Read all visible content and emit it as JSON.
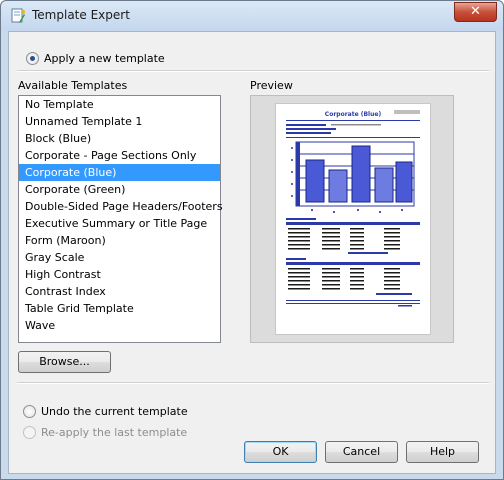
{
  "window": {
    "title": "Template Expert",
    "close_symbol": "✕"
  },
  "apply_option": {
    "label": "Apply a new template",
    "checked": true
  },
  "templates": {
    "label": "Available Templates",
    "items": [
      "No Template",
      "Unnamed Template 1",
      "Block (Blue)",
      "Corporate - Page Sections Only",
      "Corporate (Blue)",
      "Corporate (Green)",
      "Double-Sided Page Headers/Footers",
      "Executive Summary or Title Page",
      "Form (Maroon)",
      "Gray Scale",
      "High Contrast",
      "Contrast Index",
      "Table Grid Template",
      "Wave"
    ],
    "selected": "Corporate (Blue)"
  },
  "preview": {
    "label": "Preview",
    "report_title": "Corporate (Blue)"
  },
  "browse_button": {
    "label": "Browse..."
  },
  "undo_option": {
    "label": "Undo the current template",
    "checked": false
  },
  "reapply_option": {
    "label": "Re-apply the last template",
    "enabled": false
  },
  "buttons": {
    "ok": "OK",
    "cancel": "Cancel",
    "help": "Help"
  },
  "colors": {
    "selection": "#3399ff",
    "preview_accent": "#2b3aa8",
    "preview_bar": "#4a5ad6"
  },
  "icons": {
    "app": "template-wizard-icon",
    "close": "close-icon"
  }
}
